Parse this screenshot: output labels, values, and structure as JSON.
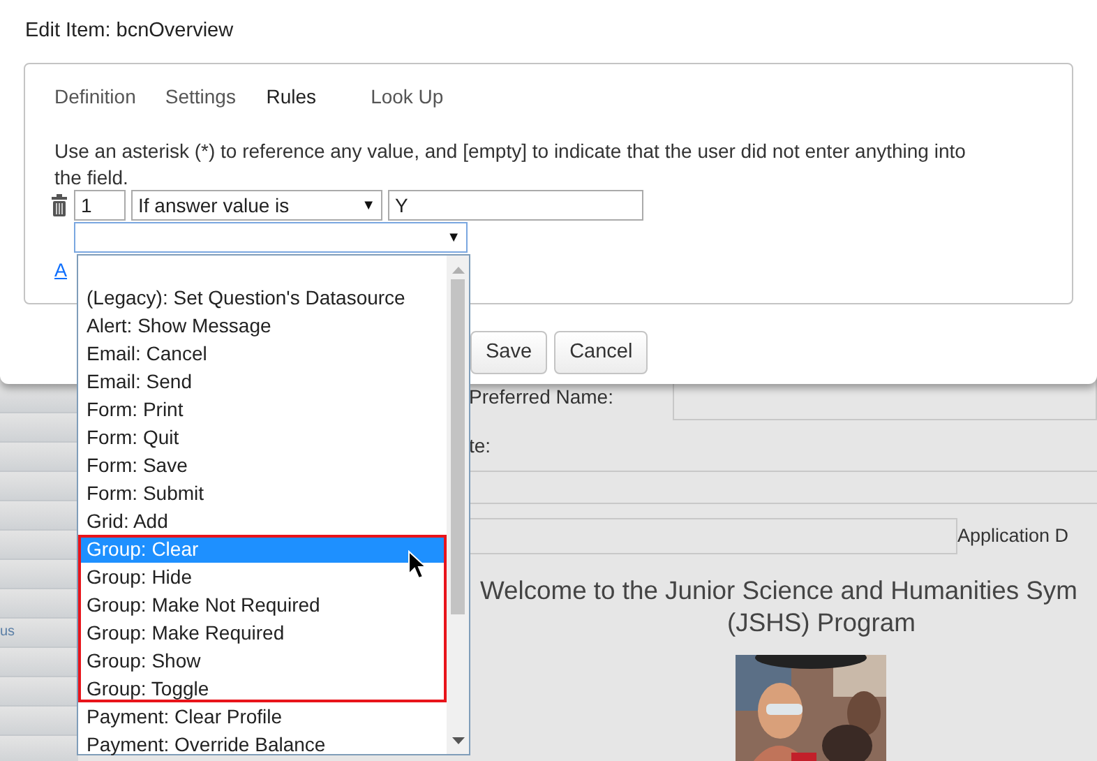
{
  "dialog": {
    "title": "Edit Item: bcnOverview",
    "tabs": [
      {
        "label": "Definition",
        "selected": false
      },
      {
        "label": "Settings",
        "selected": false
      },
      {
        "label": "Rules",
        "selected": true
      },
      {
        "label": "Look Up",
        "selected": false
      }
    ],
    "help_text": "Use an asterisk (*) to reference any value, and [empty] to indicate that the user did not enter anything into the field.",
    "rule": {
      "order": "1",
      "condition": "If answer value is",
      "condition_caret": "▼",
      "value": "Y",
      "action_focused": true,
      "action_caret": "▼",
      "action_options": [
        {
          "label": "(Legacy): Set Question's Datasource",
          "selected": false,
          "highlighted": false
        },
        {
          "label": "Alert: Show Message",
          "selected": false,
          "highlighted": false
        },
        {
          "label": "Email: Cancel",
          "selected": false,
          "highlighted": false
        },
        {
          "label": "Email: Send",
          "selected": false,
          "highlighted": false
        },
        {
          "label": "Form: Print",
          "selected": false,
          "highlighted": false
        },
        {
          "label": "Form: Quit",
          "selected": false,
          "highlighted": false
        },
        {
          "label": "Form: Save",
          "selected": false,
          "highlighted": false
        },
        {
          "label": "Form: Submit",
          "selected": false,
          "highlighted": false
        },
        {
          "label": "Grid: Add",
          "selected": false,
          "highlighted": false
        },
        {
          "label": "Group: Clear",
          "selected": true,
          "highlighted": true
        },
        {
          "label": "Group: Hide",
          "selected": false,
          "highlighted": true
        },
        {
          "label": "Group: Make Not Required",
          "selected": false,
          "highlighted": true
        },
        {
          "label": "Group: Make Required",
          "selected": false,
          "highlighted": true
        },
        {
          "label": "Group: Show",
          "selected": false,
          "highlighted": true
        },
        {
          "label": "Group: Toggle",
          "selected": false,
          "highlighted": true
        },
        {
          "label": "Payment: Clear Profile",
          "selected": false,
          "highlighted": false
        },
        {
          "label": "Payment: Override Balance",
          "selected": false,
          "highlighted": false
        }
      ]
    },
    "add_link": "A",
    "buttons": [
      "Save",
      "Cancel"
    ]
  },
  "sidebar": {
    "items": [
      "us"
    ]
  },
  "background_form": {
    "labels": [
      "Preferred Name:",
      "te:",
      "Application D"
    ],
    "heading": "Welcome to the Junior Science and Humanities Sym",
    "heading_line2": "(JSHS) Program",
    "picture": {
      "kind": "picture"
    }
  }
}
